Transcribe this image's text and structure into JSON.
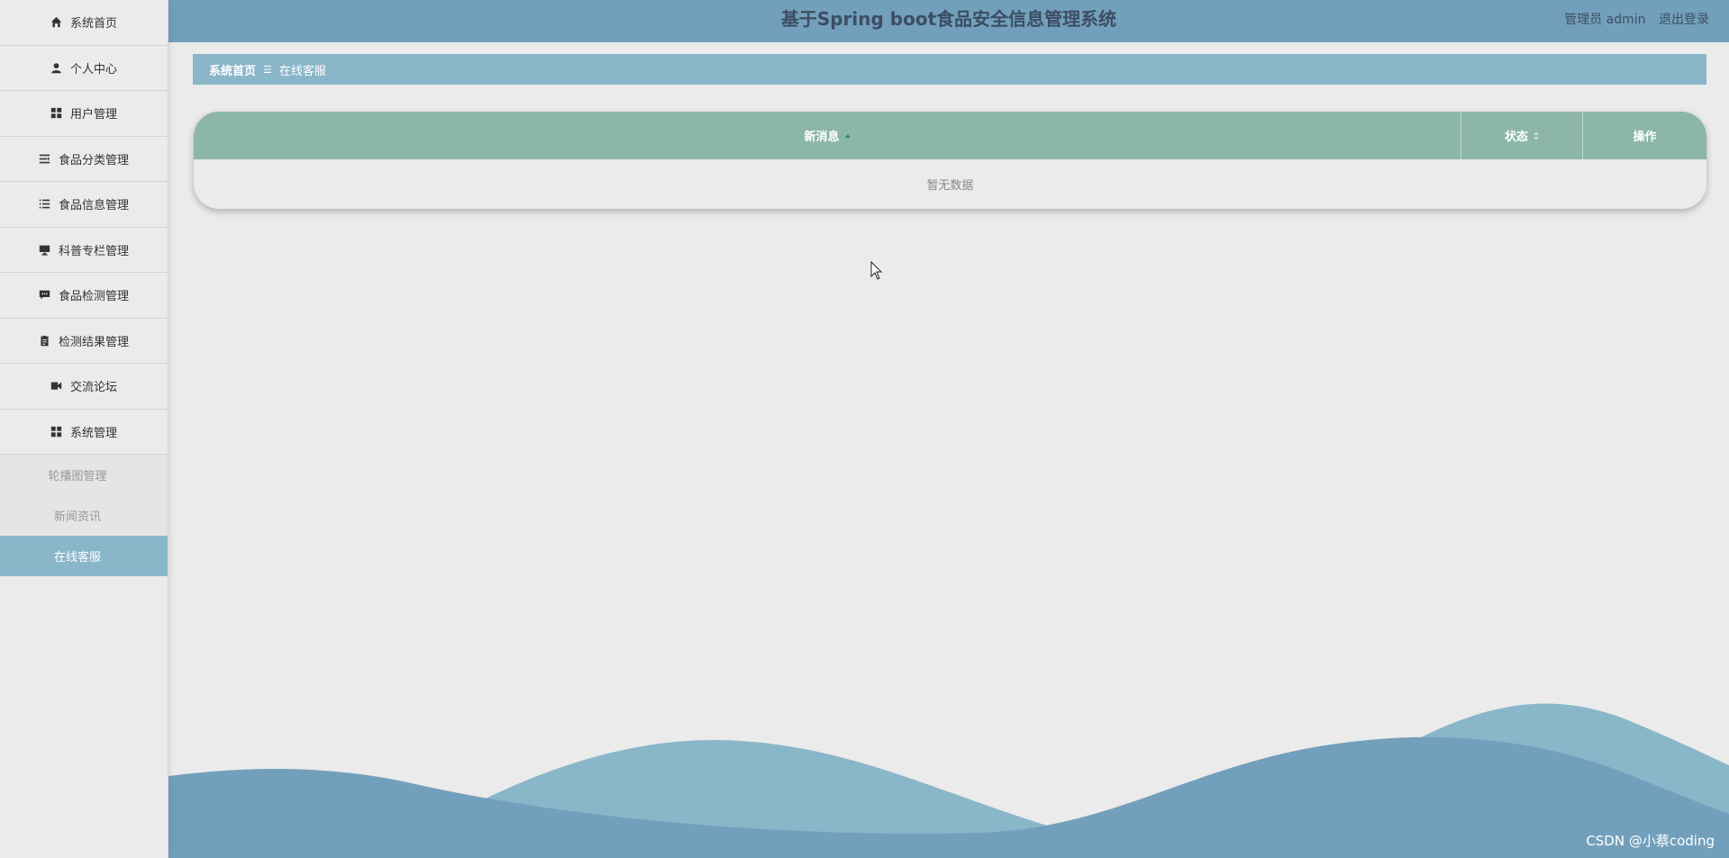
{
  "app": {
    "title": "基于Spring boot食品安全信息管理系统"
  },
  "header": {
    "user_label": "管理员 admin",
    "logout": "退出登录"
  },
  "sidebar": {
    "items": [
      {
        "label": "系统首页",
        "icon": "home-icon"
      },
      {
        "label": "个人中心",
        "icon": "person-icon"
      },
      {
        "label": "用户管理",
        "icon": "grid-icon"
      },
      {
        "label": "食品分类管理",
        "icon": "sliders-icon"
      },
      {
        "label": "食品信息管理",
        "icon": "list-icon"
      },
      {
        "label": "科普专栏管理",
        "icon": "monitor-icon"
      },
      {
        "label": "食品检测管理",
        "icon": "chat-icon"
      },
      {
        "label": "检测结果管理",
        "icon": "clipboard-icon"
      },
      {
        "label": "交流论坛",
        "icon": "video-icon"
      },
      {
        "label": "系统管理",
        "icon": "grid-icon"
      }
    ],
    "sub_items": [
      {
        "label": "轮播图管理",
        "active": false
      },
      {
        "label": "新闻资讯",
        "active": false
      },
      {
        "label": "在线客服",
        "active": true
      }
    ]
  },
  "breadcrumb": {
    "home": "系统首页",
    "separator": "☰",
    "current": "在线客服"
  },
  "table": {
    "columns": [
      "新消息",
      "状态",
      "操作"
    ],
    "empty_text": "暂无数据"
  },
  "watermark": "CSDN @小蔡coding",
  "colors": {
    "header": "#72a0bc",
    "breadcrumb": "#8ab6c9",
    "table_header": "#8bb6a8",
    "active_menu": "#8ab6c9",
    "wave_light": "#8ab6c9",
    "wave_dark": "#72a0bc"
  }
}
